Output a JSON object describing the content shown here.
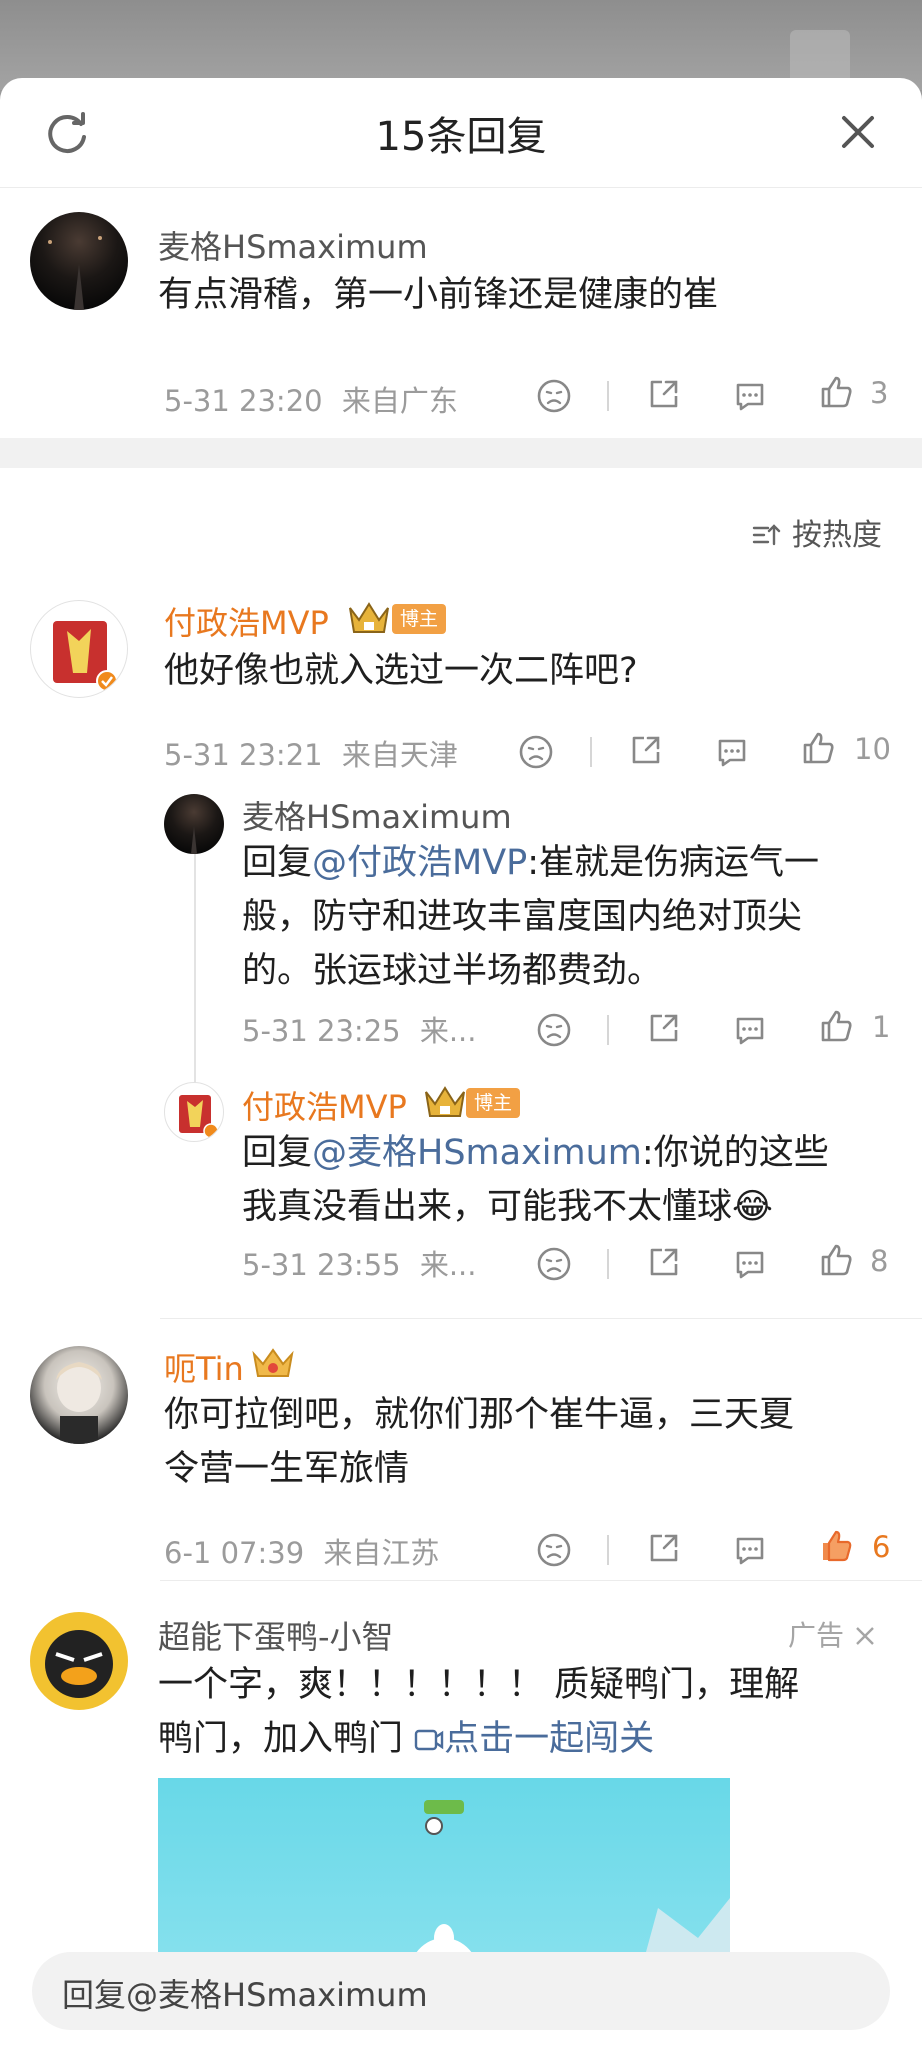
{
  "header": {
    "title": "15条回复"
  },
  "root": {
    "author": "麦格HSmaximum",
    "text": "有点滑稽，第一小前锋还是健康的崔",
    "time": "5-31 23:20",
    "location": "来自广东",
    "likes": "3"
  },
  "sort": {
    "label": "按热度"
  },
  "comments": [
    {
      "author": "付政浩MVP",
      "badge": "博主",
      "text": "他好像也就入选过一次二阵吧?",
      "time": "5-31 23:21",
      "location": "来自天津",
      "likes": "10",
      "replies": [
        {
          "author": "麦格HSmaximum",
          "prefix": "回复",
          "mention": "@付政浩MVP",
          "text_lines": [
            ":崔就是伤病运气一",
            "般，防守和进攻丰富度国内绝对顶尖",
            "的。张运球过半场都费劲。"
          ],
          "time": "5-31 23:25",
          "location": "来...",
          "likes": "1"
        },
        {
          "author": "付政浩MVP",
          "badge": "博主",
          "prefix": "回复",
          "mention": "@麦格HSmaximum",
          "text_lines": [
            ":你说的这些",
            "我真没看出来，可能我不太懂球😂"
          ],
          "time": "5-31 23:55",
          "location": "来...",
          "likes": "8"
        }
      ]
    },
    {
      "author": "呃Tin",
      "text_lines": [
        "你可拉倒吧，就你们那个崔牛逼，三天夏",
        "令营一生军旅情"
      ],
      "time": "6-1 07:39",
      "location": "来自江苏",
      "likes": "6"
    }
  ],
  "ad": {
    "author": "超能下蛋鸭-小智",
    "tag": "广告",
    "text_lines": [
      "一个字，爽！！！！！！ 质疑鸭门，理解",
      "鸭门，加入鸭门 "
    ],
    "link": "点击一起闯关"
  },
  "reply_box": {
    "placeholder": "回复@麦格HSmaximum"
  }
}
